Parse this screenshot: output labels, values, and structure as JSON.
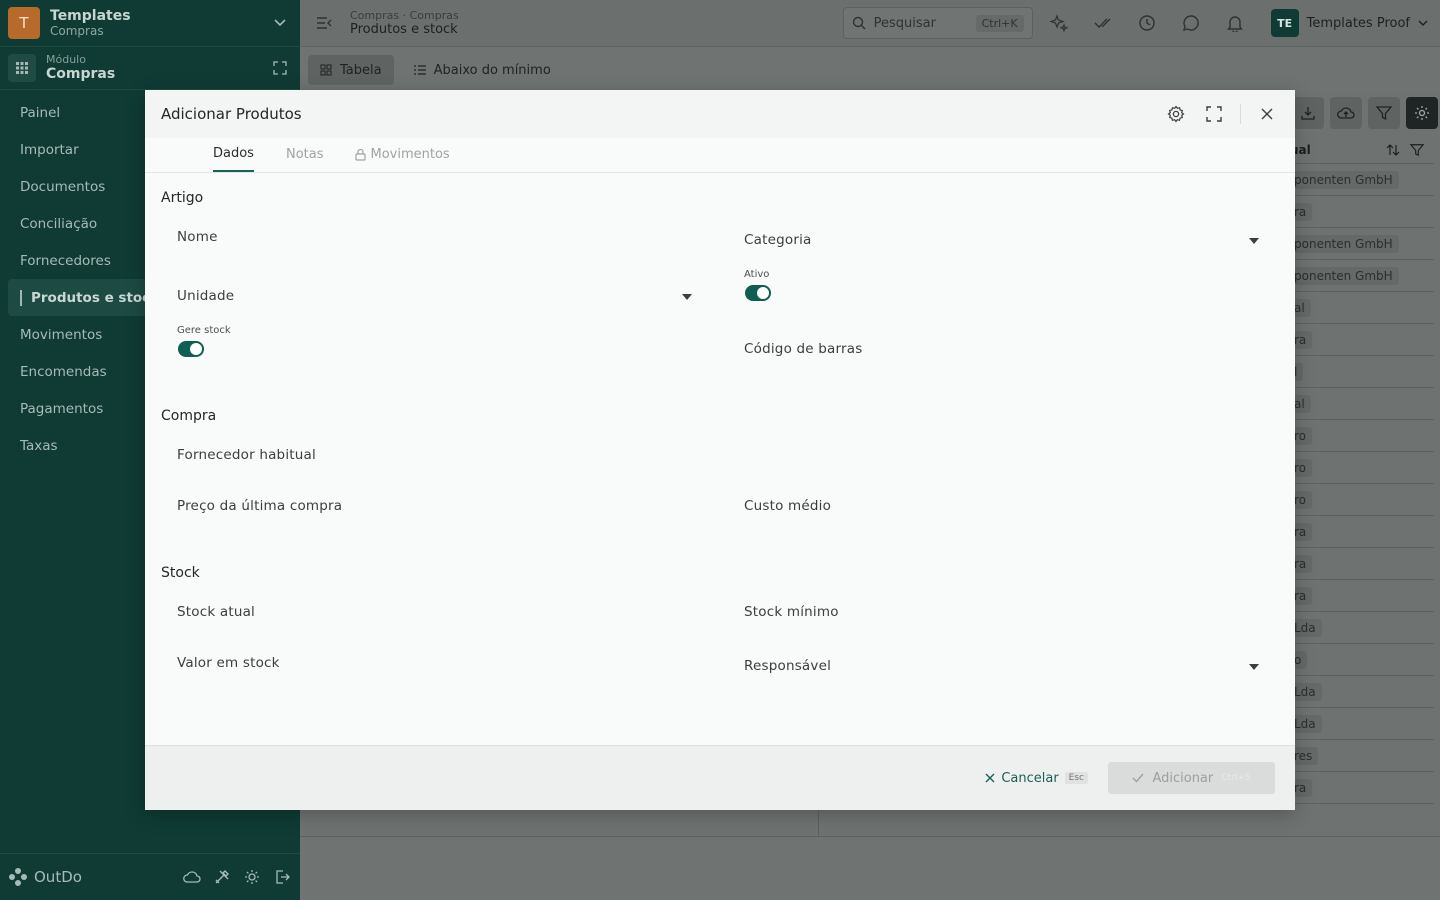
{
  "org": {
    "initial": "T",
    "name": "Templates",
    "sub": "Compras"
  },
  "module": {
    "label": "Módulo",
    "name": "Compras"
  },
  "nav": [
    {
      "label": "Painel"
    },
    {
      "label": "Importar"
    },
    {
      "label": "Documentos"
    },
    {
      "label": "Conciliação"
    },
    {
      "label": "Fornecedores"
    },
    {
      "label": "Produtos e stock",
      "active": true
    },
    {
      "label": "Movimentos"
    },
    {
      "label": "Encomendas"
    },
    {
      "label": "Pagamentos"
    },
    {
      "label": "Taxas"
    }
  ],
  "brand": "OutDo",
  "topbar": {
    "crumb": "Compras · Compras",
    "title": "Produtos e stock",
    "search_placeholder": "Pesquisar",
    "search_kbd": "Ctrl+K",
    "user_initials": "TE",
    "user_name": "Templates Proof"
  },
  "views": {
    "table": "Tabela",
    "below_min": "Abaixo do mínimo"
  },
  "bg_table": {
    "header": "ual",
    "rows": [
      "ponenten GmbH",
      "ra",
      "ponenten GmbH",
      "ponenten GmbH",
      "al",
      "ra",
      "l",
      "al",
      "ro",
      "ro",
      "ro",
      "ra",
      "ra",
      "ra",
      "Lda",
      "o",
      "Lda",
      "Lda",
      "res",
      "ra"
    ]
  },
  "modal": {
    "title": "Adicionar Produtos",
    "tabs": [
      "Dados",
      "Notas",
      "Movimentos"
    ],
    "sections": {
      "artigo": "Artigo",
      "compra": "Compra",
      "stock": "Stock"
    },
    "fields": {
      "nome": "Nome",
      "categoria": "Categoria",
      "unidade": "Unidade",
      "ativo_label": "Ativo",
      "gere_stock_label": "Gere stock",
      "codigo_barras": "Código de barras",
      "fornecedor": "Fornecedor habitual",
      "preco_ultima": "Preço da última compra",
      "custo_medio": "Custo médio",
      "stock_atual": "Stock atual",
      "stock_minimo": "Stock mínimo",
      "valor_stock": "Valor em stock",
      "responsavel": "Responsável"
    },
    "toggles": {
      "ativo": true,
      "gere_stock": true
    },
    "footer": {
      "cancel": "Cancelar",
      "cancel_kbd": "Esc",
      "add": "Adicionar",
      "add_kbd": "Ctrl+S"
    }
  },
  "colors": {
    "sidebar": "#0f3b34",
    "accent": "#1a6156",
    "toggle_on": "#0f5e52"
  }
}
